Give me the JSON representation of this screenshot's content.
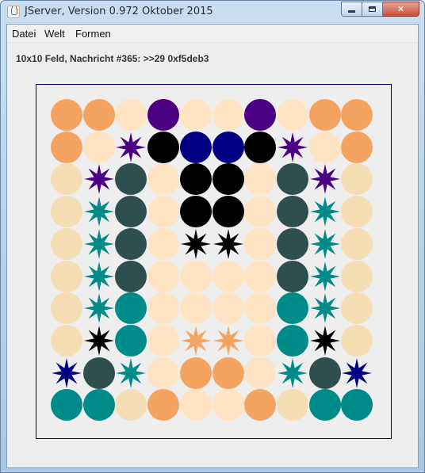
{
  "window": {
    "title": "JServer, Version 0.972 Oktober 2015",
    "minimize_glyph": "",
    "maximize_glyph": "",
    "close_glyph": "✕"
  },
  "menu": {
    "datei": "Datei",
    "welt": "Welt",
    "formen": "Formen"
  },
  "status": {
    "message": "10x10 Feld, Nachricht #365: >>29 0xf5deb3"
  },
  "icons": {
    "app": "java-icon",
    "minimize": "minimize-icon",
    "maximize": "maximize-icon",
    "close": "close-icon"
  },
  "board": {
    "rows": 10,
    "cols": 10,
    "border_color": "#000080",
    "background": "#eeeeee",
    "palette": {
      "s": "#f4a460",
      "p": "#ffe4c4",
      "w": "#f5deb3",
      "i": "#4b0082",
      "n": "#000080",
      "k": "#000000",
      "d": "#2f4f4f",
      "t": "#008b8b"
    },
    "cells": [
      [
        {
          "shape": "circle",
          "c": "s"
        },
        {
          "shape": "circle",
          "c": "s"
        },
        {
          "shape": "circle",
          "c": "p"
        },
        {
          "shape": "circle",
          "c": "i"
        },
        {
          "shape": "circle",
          "c": "p"
        },
        {
          "shape": "circle",
          "c": "p"
        },
        {
          "shape": "circle",
          "c": "i"
        },
        {
          "shape": "circle",
          "c": "p"
        },
        {
          "shape": "circle",
          "c": "s"
        },
        {
          "shape": "circle",
          "c": "s"
        }
      ],
      [
        {
          "shape": "circle",
          "c": "s"
        },
        {
          "shape": "circle",
          "c": "p"
        },
        {
          "shape": "star",
          "c": "i"
        },
        {
          "shape": "circle",
          "c": "k"
        },
        {
          "shape": "circle",
          "c": "n"
        },
        {
          "shape": "circle",
          "c": "n"
        },
        {
          "shape": "circle",
          "c": "k"
        },
        {
          "shape": "star",
          "c": "i"
        },
        {
          "shape": "circle",
          "c": "p"
        },
        {
          "shape": "circle",
          "c": "s"
        }
      ],
      [
        {
          "shape": "circle",
          "c": "w"
        },
        {
          "shape": "star",
          "c": "i"
        },
        {
          "shape": "circle",
          "c": "d"
        },
        {
          "shape": "circle",
          "c": "p"
        },
        {
          "shape": "circle",
          "c": "k"
        },
        {
          "shape": "circle",
          "c": "k"
        },
        {
          "shape": "circle",
          "c": "p"
        },
        {
          "shape": "circle",
          "c": "d"
        },
        {
          "shape": "star",
          "c": "i"
        },
        {
          "shape": "circle",
          "c": "w"
        }
      ],
      [
        {
          "shape": "circle",
          "c": "w"
        },
        {
          "shape": "star",
          "c": "t"
        },
        {
          "shape": "circle",
          "c": "d"
        },
        {
          "shape": "circle",
          "c": "p"
        },
        {
          "shape": "circle",
          "c": "k"
        },
        {
          "shape": "circle",
          "c": "k"
        },
        {
          "shape": "circle",
          "c": "p"
        },
        {
          "shape": "circle",
          "c": "d"
        },
        {
          "shape": "star",
          "c": "t"
        },
        {
          "shape": "circle",
          "c": "w"
        }
      ],
      [
        {
          "shape": "circle",
          "c": "w"
        },
        {
          "shape": "star",
          "c": "t"
        },
        {
          "shape": "circle",
          "c": "d"
        },
        {
          "shape": "circle",
          "c": "p"
        },
        {
          "shape": "star",
          "c": "k"
        },
        {
          "shape": "star",
          "c": "k"
        },
        {
          "shape": "circle",
          "c": "p"
        },
        {
          "shape": "circle",
          "c": "d"
        },
        {
          "shape": "star",
          "c": "t"
        },
        {
          "shape": "circle",
          "c": "w"
        }
      ],
      [
        {
          "shape": "circle",
          "c": "w"
        },
        {
          "shape": "star",
          "c": "t"
        },
        {
          "shape": "circle",
          "c": "d"
        },
        {
          "shape": "circle",
          "c": "p"
        },
        {
          "shape": "circle",
          "c": "p"
        },
        {
          "shape": "circle",
          "c": "p"
        },
        {
          "shape": "circle",
          "c": "p"
        },
        {
          "shape": "circle",
          "c": "d"
        },
        {
          "shape": "star",
          "c": "t"
        },
        {
          "shape": "circle",
          "c": "w"
        }
      ],
      [
        {
          "shape": "circle",
          "c": "w"
        },
        {
          "shape": "star",
          "c": "t"
        },
        {
          "shape": "circle",
          "c": "t"
        },
        {
          "shape": "circle",
          "c": "p"
        },
        {
          "shape": "circle",
          "c": "p"
        },
        {
          "shape": "circle",
          "c": "p"
        },
        {
          "shape": "circle",
          "c": "p"
        },
        {
          "shape": "circle",
          "c": "t"
        },
        {
          "shape": "star",
          "c": "t"
        },
        {
          "shape": "circle",
          "c": "w"
        }
      ],
      [
        {
          "shape": "circle",
          "c": "w"
        },
        {
          "shape": "star",
          "c": "k"
        },
        {
          "shape": "circle",
          "c": "t"
        },
        {
          "shape": "circle",
          "c": "p"
        },
        {
          "shape": "star",
          "c": "s"
        },
        {
          "shape": "star",
          "c": "s"
        },
        {
          "shape": "circle",
          "c": "p"
        },
        {
          "shape": "circle",
          "c": "t"
        },
        {
          "shape": "star",
          "c": "k"
        },
        {
          "shape": "circle",
          "c": "w"
        }
      ],
      [
        {
          "shape": "star",
          "c": "n"
        },
        {
          "shape": "circle",
          "c": "d"
        },
        {
          "shape": "star",
          "c": "t"
        },
        {
          "shape": "circle",
          "c": "p"
        },
        {
          "shape": "circle",
          "c": "s"
        },
        {
          "shape": "circle",
          "c": "s"
        },
        {
          "shape": "circle",
          "c": "p"
        },
        {
          "shape": "star",
          "c": "t"
        },
        {
          "shape": "circle",
          "c": "d"
        },
        {
          "shape": "star",
          "c": "n"
        }
      ],
      [
        {
          "shape": "circle",
          "c": "t"
        },
        {
          "shape": "circle",
          "c": "t"
        },
        {
          "shape": "circle",
          "c": "w"
        },
        {
          "shape": "circle",
          "c": "s"
        },
        {
          "shape": "circle",
          "c": "p"
        },
        {
          "shape": "circle",
          "c": "p"
        },
        {
          "shape": "circle",
          "c": "s"
        },
        {
          "shape": "circle",
          "c": "w"
        },
        {
          "shape": "circle",
          "c": "t"
        },
        {
          "shape": "circle",
          "c": "t"
        }
      ]
    ]
  }
}
